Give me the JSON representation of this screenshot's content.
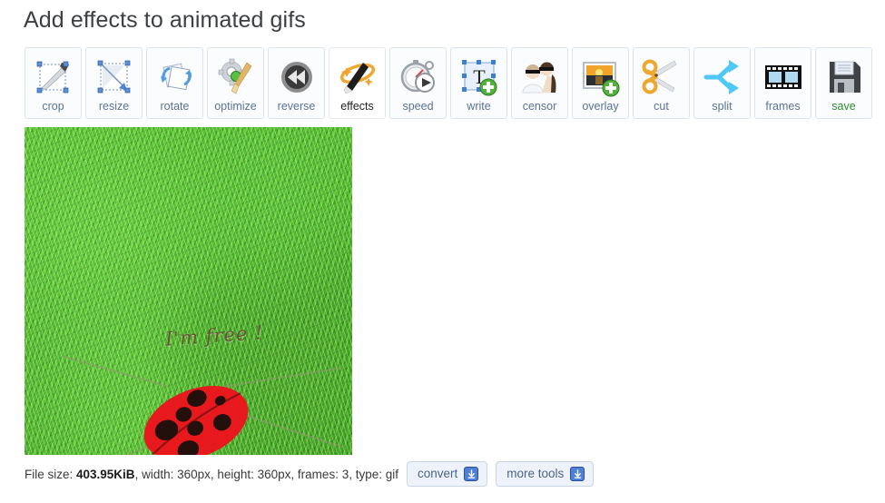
{
  "header": {
    "title": "Add effects to animated gifs"
  },
  "toolbar": {
    "items": [
      {
        "label": "crop",
        "icon": "crop-icon",
        "active": false
      },
      {
        "label": "resize",
        "icon": "resize-icon",
        "active": false
      },
      {
        "label": "rotate",
        "icon": "rotate-icon",
        "active": false
      },
      {
        "label": "optimize",
        "icon": "optimize-icon",
        "active": false
      },
      {
        "label": "reverse",
        "icon": "reverse-icon",
        "active": false
      },
      {
        "label": "effects",
        "icon": "effects-icon",
        "active": true
      },
      {
        "label": "speed",
        "icon": "speed-icon",
        "active": false
      },
      {
        "label": "write",
        "icon": "write-icon",
        "active": false
      },
      {
        "label": "censor",
        "icon": "censor-icon",
        "active": false
      },
      {
        "label": "overlay",
        "icon": "overlay-icon",
        "active": false
      },
      {
        "label": "cut",
        "icon": "cut-icon",
        "active": false
      },
      {
        "label": "split",
        "icon": "split-icon",
        "active": false
      },
      {
        "label": "frames",
        "icon": "frames-icon",
        "active": false
      },
      {
        "label": "save",
        "icon": "save-icon",
        "active": false
      }
    ]
  },
  "preview": {
    "caption_text": "I'm free !",
    "alt": "animated gif of a red ladybug on green grass"
  },
  "status": {
    "prefix": "File size: ",
    "file_size": "403.95KiB",
    "details": ", width: 360px, height: 360px, frames: 3, type: gif",
    "convert_label": "convert",
    "more_tools_label": "more tools"
  },
  "colors": {
    "accent_blue": "#4f7fd6",
    "label_blue": "#5a7394",
    "save_green": "#2e8b2e",
    "title_gray": "#3c4043",
    "button_bg": "#fbfcfe",
    "button_border": "#dde3ec"
  }
}
